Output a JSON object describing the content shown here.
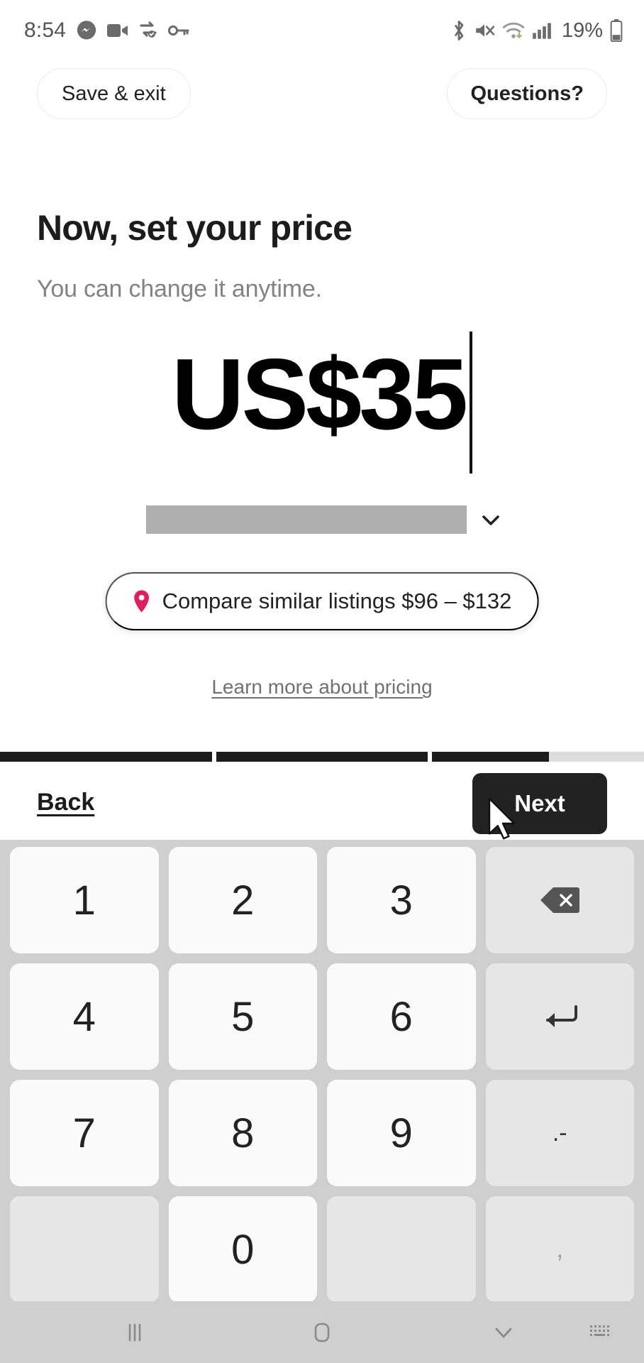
{
  "statusbar": {
    "time": "8:54",
    "battery_pct": "19%",
    "left_icons": [
      "messenger-icon",
      "video-camera-icon",
      "vpn-sync-icon",
      "key-icon"
    ],
    "right_icons": [
      "bluetooth-icon",
      "mute-icon",
      "wifi-icon",
      "signal-icon",
      "battery-icon"
    ]
  },
  "topbar": {
    "save_exit_label": "Save & exit",
    "questions_label": "Questions?"
  },
  "main": {
    "headline": "Now, set your price",
    "subtitle": "You can change it anytime.",
    "price_value": "US$35",
    "compare_label": "Compare similar listings $96 – $132",
    "learn_more_label": "Learn more about pricing",
    "pin_color": "#E31C5F"
  },
  "progress": {
    "segments": [
      100,
      100,
      55
    ],
    "fill_color": "#1c1c1c",
    "track_color": "#dddddd"
  },
  "footer": {
    "back_label": "Back",
    "next_label": "Next",
    "next_bg": "#222222"
  },
  "keyboard": {
    "rows": [
      [
        {
          "label": "1",
          "kind": "digit"
        },
        {
          "label": "2",
          "kind": "digit"
        },
        {
          "label": "3",
          "kind": "digit"
        },
        {
          "label": "",
          "kind": "backspace"
        }
      ],
      [
        {
          "label": "4",
          "kind": "digit"
        },
        {
          "label": "5",
          "kind": "digit"
        },
        {
          "label": "6",
          "kind": "digit"
        },
        {
          "label": "",
          "kind": "enter"
        }
      ],
      [
        {
          "label": "7",
          "kind": "digit"
        },
        {
          "label": "8",
          "kind": "digit"
        },
        {
          "label": "9",
          "kind": "digit"
        },
        {
          "label": ".-",
          "kind": "sym"
        }
      ],
      [
        {
          "label": "",
          "kind": "blank"
        },
        {
          "label": "0",
          "kind": "digit"
        },
        {
          "label": "",
          "kind": "blank"
        },
        {
          "label": ",",
          "kind": "sym-faint"
        }
      ]
    ]
  },
  "navbar": {
    "items": [
      "recents-icon",
      "home-icon",
      "hide-keyboard-icon",
      "keyboard-switch-icon"
    ]
  }
}
